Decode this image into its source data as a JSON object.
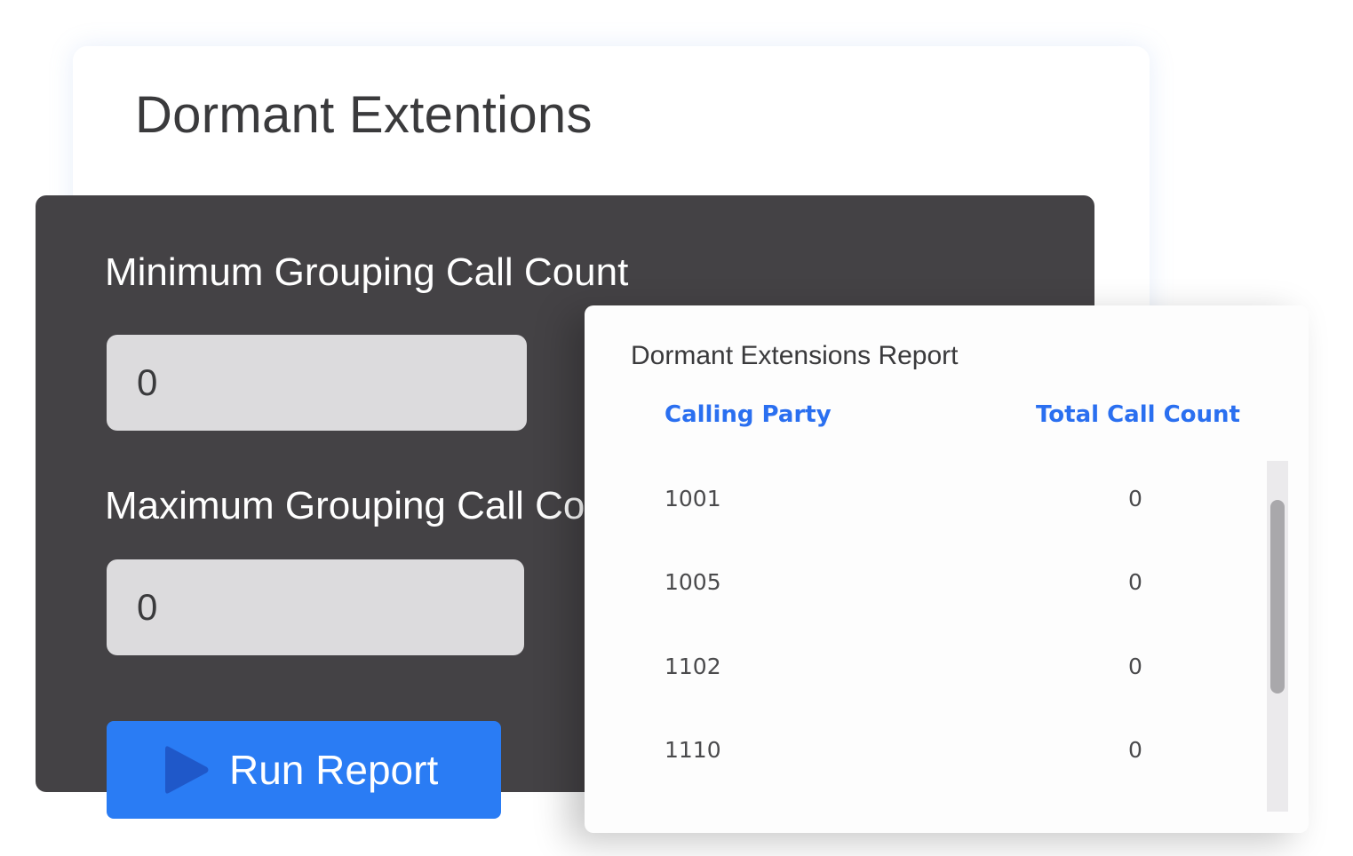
{
  "page": {
    "title": "Dormant Extentions"
  },
  "form": {
    "min_label": "Minimum Grouping Call Count",
    "min_value": "0",
    "max_label": "Maximum Grouping Call Count",
    "max_value": "0",
    "run_button_label": "Run Report",
    "run_button_icon": "play-icon",
    "accent_color": "#2a7cf4",
    "panel_color": "#444245"
  },
  "report": {
    "title": "Dormant Extensions Report",
    "columns": [
      "Calling Party",
      "Total Call Count"
    ],
    "header_color": "#2a6ff0",
    "rows": [
      {
        "calling_party": "1001",
        "total_call_count": "0"
      },
      {
        "calling_party": "1005",
        "total_call_count": "0"
      },
      {
        "calling_party": "1102",
        "total_call_count": "0"
      },
      {
        "calling_party": "1110",
        "total_call_count": "0"
      }
    ]
  }
}
